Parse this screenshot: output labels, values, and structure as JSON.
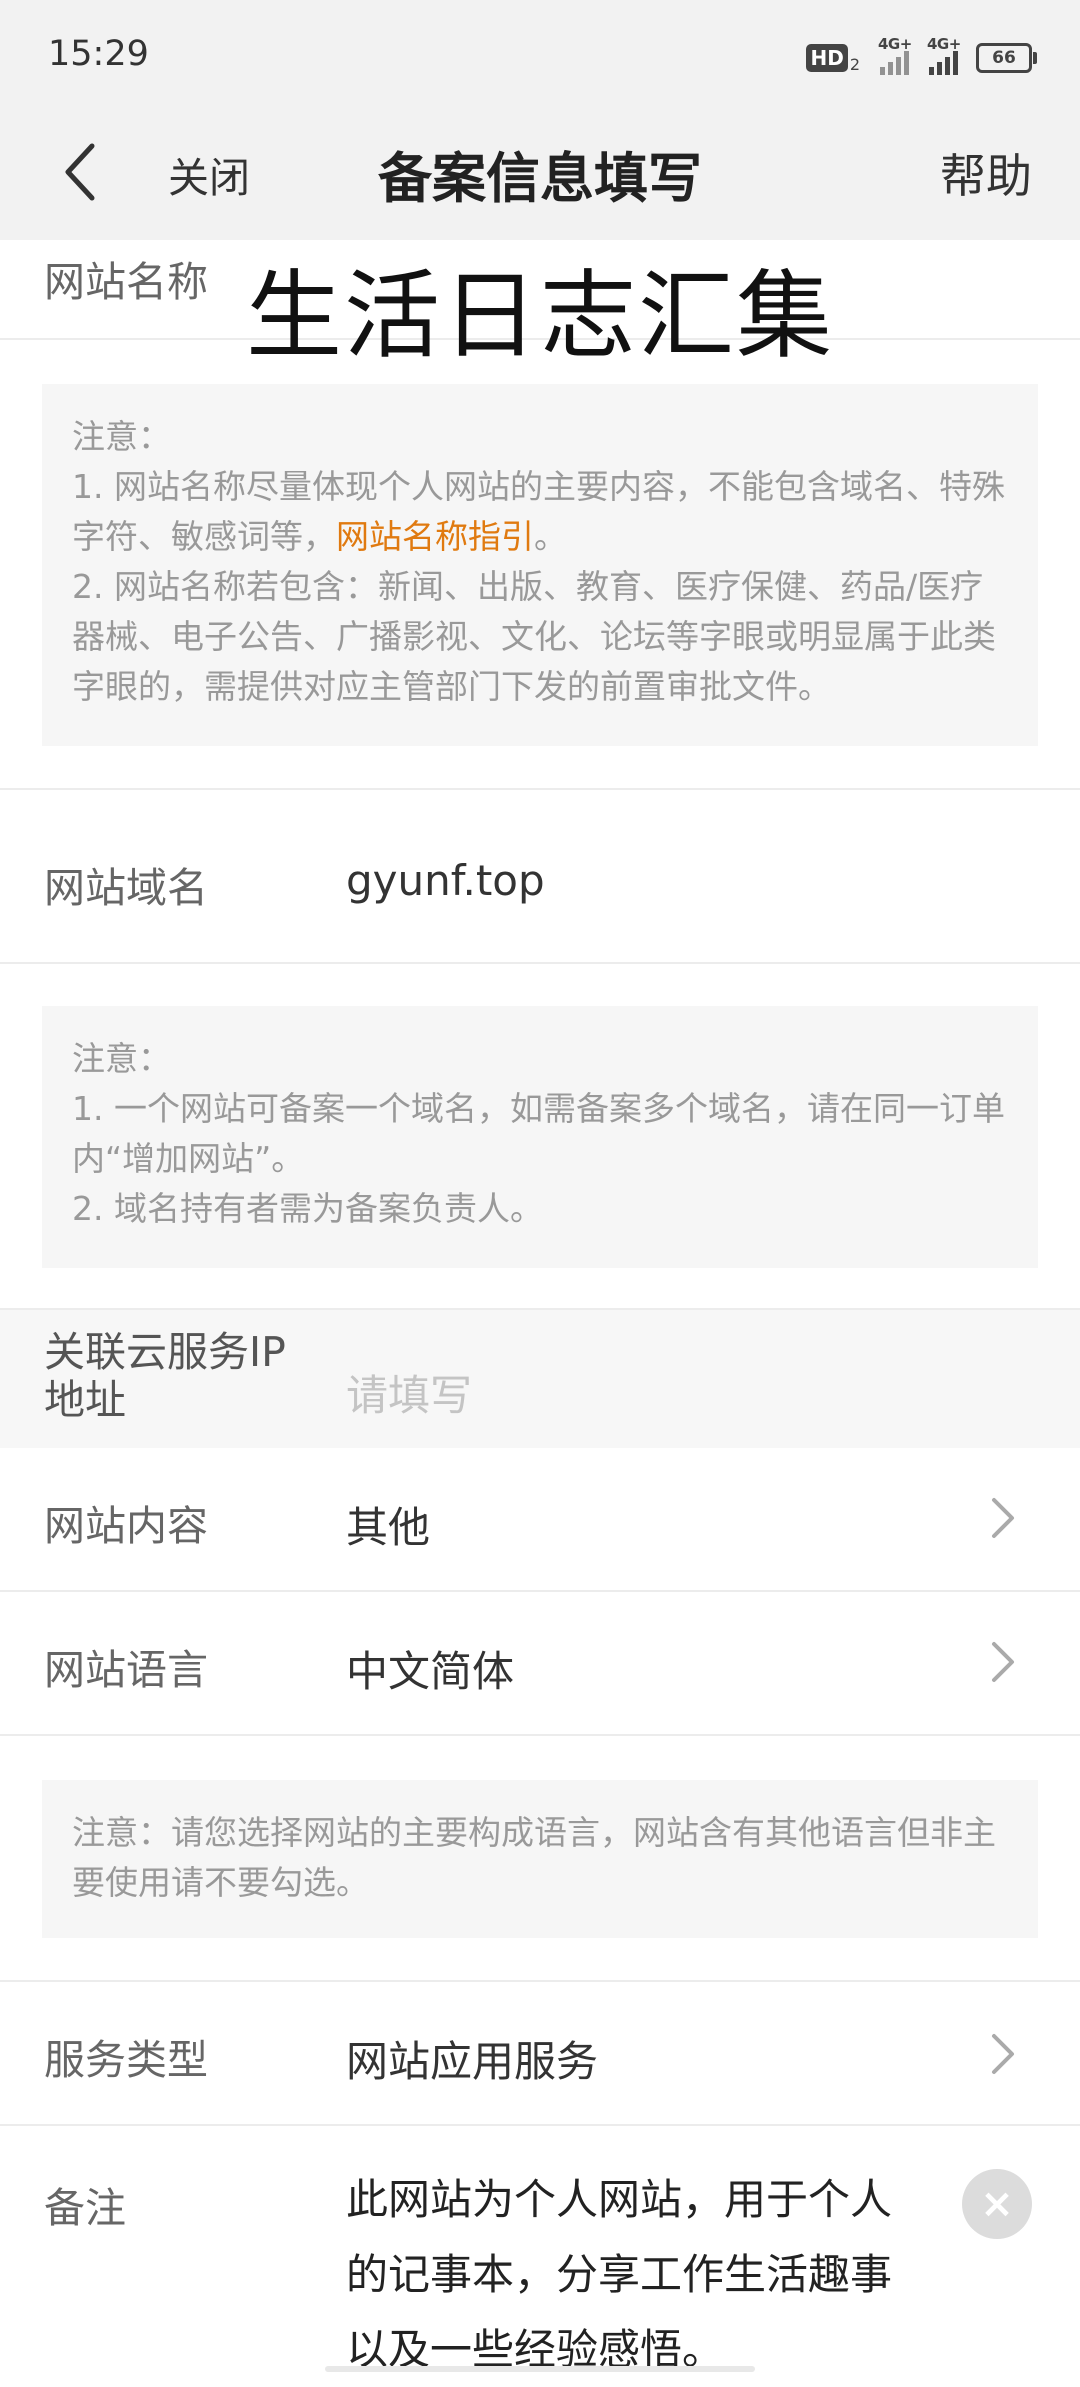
{
  "status_bar": {
    "time": "15:29",
    "hd_label": "HD",
    "hd_sub": "2",
    "sim1_label": "4G+",
    "sim2_label": "4G+",
    "battery": "66"
  },
  "nav": {
    "close_label": "关闭",
    "title": "备案信息填写",
    "help_label": "帮助"
  },
  "site_name": {
    "label": "网站名称",
    "value": "生活日志汇集"
  },
  "note1": {
    "heading": "注意：",
    "line1_prefix": "1. 网站名称尽量体现个人网站的主要内容，不能包含域名、特殊字符、敏感词等，",
    "line1_link": "网站名称指引",
    "line1_suffix": "。",
    "line2": "2. 网站名称若包含：新闻、出版、教育、医疗保健、药品/医疗器械、电子公告、广播影视、文化、论坛等字眼或明显属于此类字眼的，需提供对应主管部门下发的前置审批文件。"
  },
  "domain": {
    "label": "网站域名",
    "value": "gyunf.top"
  },
  "note2": {
    "heading": "注意：",
    "line1": "1. 一个网站可备案一个域名，如需备案多个域名，请在同一订单内“增加网站”。",
    "line2": "2. 域名持有者需为备案负责人。"
  },
  "ip": {
    "label_line1": "关联云服务IP",
    "label_line2": "地址",
    "placeholder": "请填写"
  },
  "content": {
    "label": "网站内容",
    "value": "其他"
  },
  "language": {
    "label": "网站语言",
    "value": "中文简体"
  },
  "note3": {
    "text": "注意：请您选择网站的主要构成语言，网站含有其他语言但非主要使用请不要勾选。"
  },
  "service": {
    "label": "服务类型",
    "value": "网站应用服务"
  },
  "remark": {
    "label": "备注",
    "value": "此网站为个人网站，用于个人的记事本，分享工作生活趣事以及一些经验感悟。",
    "clear_symbol": "×"
  }
}
